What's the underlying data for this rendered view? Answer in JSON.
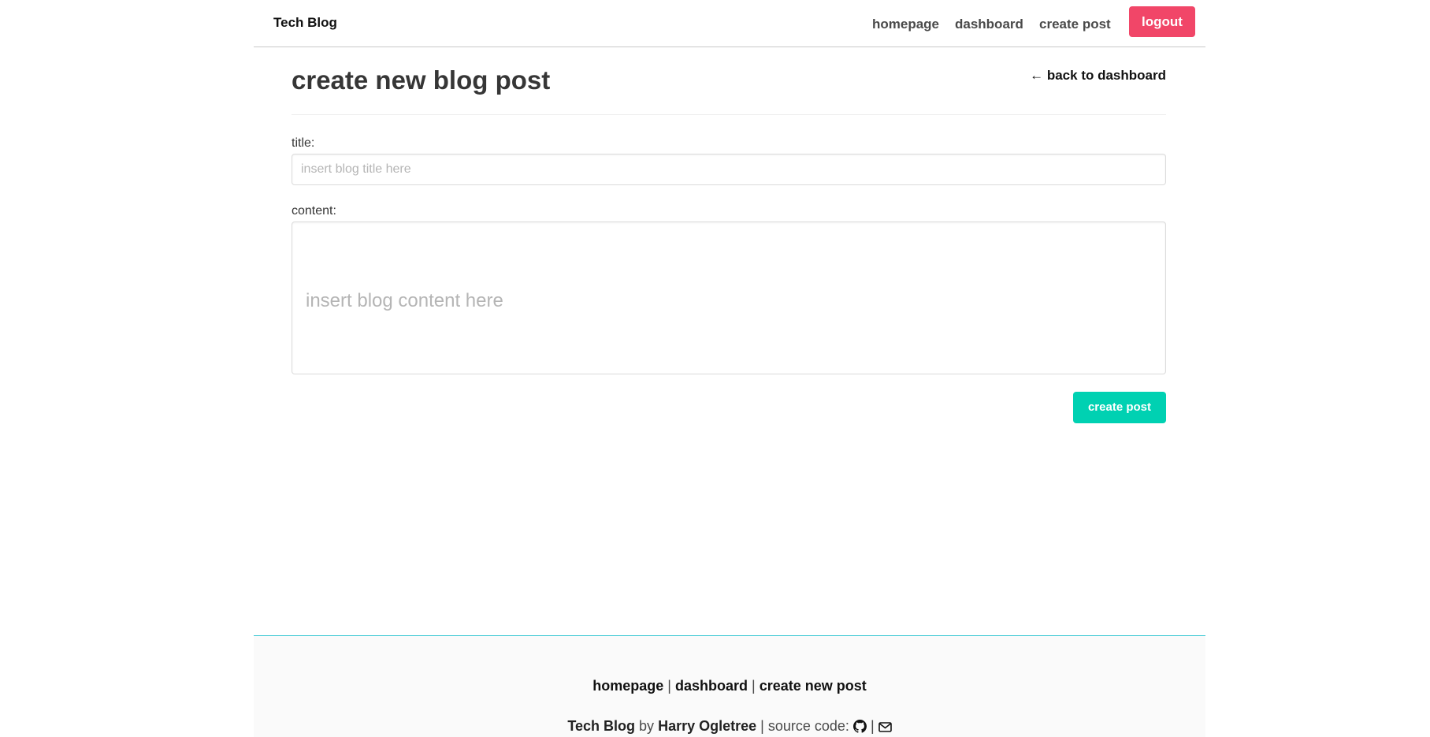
{
  "navbar": {
    "brand": "Tech Blog",
    "links": {
      "homepage": "homepage",
      "dashboard": "dashboard",
      "create_post": "create post"
    },
    "logout_label": "logout"
  },
  "main": {
    "title": "create new blog post",
    "back_link": "← back to dashboard",
    "form": {
      "title_label": "title:",
      "title_placeholder": "insert blog title here",
      "title_value": "",
      "content_label": "content:",
      "content_placeholder": "insert blog content here",
      "content_value": "",
      "submit_label": "create post"
    }
  },
  "footer": {
    "links": {
      "homepage": "homepage",
      "dashboard": "dashboard",
      "create_new_post": "create new post"
    },
    "separator": "|",
    "brand": "Tech Blog",
    "by_text": "by",
    "author": "Harry Ogletree",
    "source_text": "| source code:",
    "icons": {
      "github": "github-icon",
      "email": "envelope-icon"
    }
  },
  "colors": {
    "logout_bg": "#f14668",
    "create_bg": "#00d1b2",
    "footer_border": "#2ec4d0",
    "footer_bg": "#fafafa"
  }
}
